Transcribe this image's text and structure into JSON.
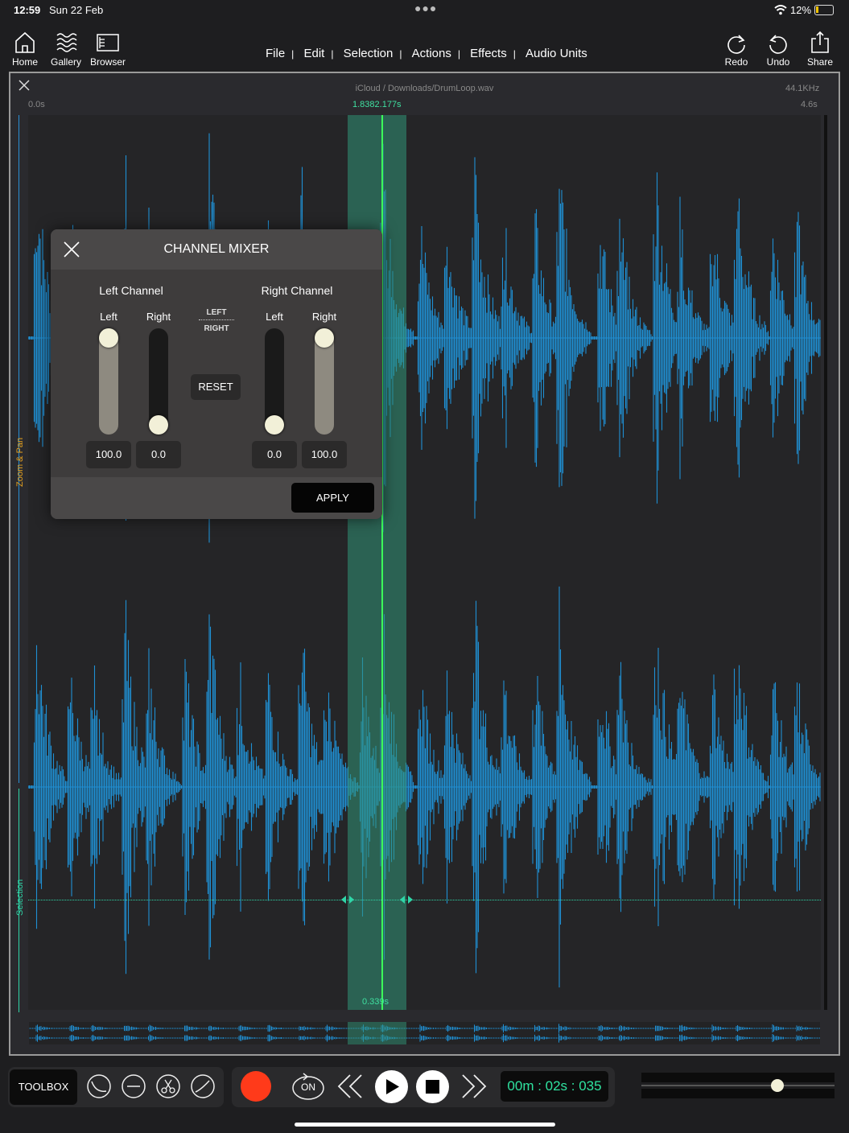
{
  "status": {
    "time": "12:59",
    "date": "Sun 22 Feb",
    "battery": "12%"
  },
  "toolbar": {
    "left": [
      {
        "label": "Home",
        "icon": "home-icon"
      },
      {
        "label": "Gallery",
        "icon": "waves-icon"
      },
      {
        "label": "Browser",
        "icon": "browser-icon"
      }
    ],
    "right": [
      {
        "label": "Redo",
        "icon": "redo-icon"
      },
      {
        "label": "Undo",
        "icon": "undo-icon"
      },
      {
        "label": "Share",
        "icon": "share-icon"
      }
    ]
  },
  "menu": [
    "File",
    "Edit",
    "Selection",
    "Actions",
    "Effects",
    "Audio Units"
  ],
  "editor": {
    "path": "iCloud / Downloads/DrumLoop.wav",
    "sample_rate": "44.1KHz",
    "time_start": "0.0s",
    "time_end": "4.6s",
    "sel_start": "1.838",
    "sel_end": "2.177s",
    "sel_length": "0.339s",
    "zoom_label": "Zoom & Pan",
    "selection_label": "Selection"
  },
  "mixer": {
    "title": "CHANNEL MIXER",
    "left_channel": "Left Channel",
    "right_channel": "Right Channel",
    "left": "Left",
    "right": "Right",
    "swap_top": "LEFT",
    "swap_bottom": "RIGHT",
    "reset": "RESET",
    "apply": "APPLY",
    "values": {
      "ll": "100.0",
      "lr": "0.0",
      "rl": "0.0",
      "rr": "100.0"
    },
    "levels": {
      "ll": 1.0,
      "lr": 0.0,
      "rl": 0.0,
      "rr": 1.0
    }
  },
  "transport": {
    "toolbox": "TOOLBOX",
    "loop": "ON",
    "time": "00m : 02s : 035",
    "volume": 0.72
  },
  "colors": {
    "wave": "#1f8fd2",
    "selection": "#2e9478",
    "playhead": "#3cff5a",
    "record": "#ff3a1a",
    "time": "#2fe3a0"
  }
}
